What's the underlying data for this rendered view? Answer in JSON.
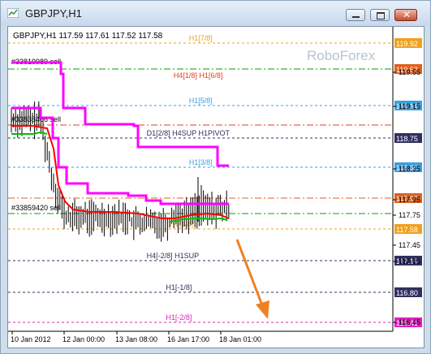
{
  "window": {
    "title": "GBPJPY,H1",
    "buttons": [
      "minimize",
      "maximize",
      "close"
    ]
  },
  "chart": {
    "header": "GBPJPY,H1  117.59 117.61 117.52 117.58",
    "watermark": "RoboForex",
    "time_labels": [
      "10 Jan 2012",
      "12 Jan 00:00",
      "13 Jan 08:00",
      "16 Jan 17:00",
      "18 Jan 01:00"
    ],
    "levels": [
      {
        "name": "H1[7/8]",
        "price": "119.92",
        "color": "#f0a020",
        "badge": "#f0a020",
        "style": "dash",
        "label_x_frac": 0.47
      },
      {
        "name": "",
        "price": "119.53",
        "color": "#00a000",
        "badge": "#e06020",
        "style": "dashdot",
        "label_x_frac": 0
      },
      {
        "name": "H4[1/8] H1[6/8]",
        "price": "",
        "color": "#e04020",
        "badge": "",
        "style": "none",
        "label_x_frac": 0.43
      },
      {
        "name": "H1[5/8]",
        "price": "119.14",
        "color": "#3aa0e0",
        "badge": "#3aa0e0",
        "style": "dash",
        "label_x_frac": 0.47
      },
      {
        "name": "",
        "price": "",
        "color": "#e04020",
        "badge": "",
        "style": "dashdot",
        "label_x_frac": 0
      },
      {
        "name": "D1[2/8] H4SUP H1PIVOT",
        "price": "118.75",
        "color": "#303060",
        "badge": "#303060",
        "style": "dash",
        "label_x_frac": 0.36
      },
      {
        "name": "H1[3/8]",
        "price": "118.36",
        "color": "#3aa0e0",
        "badge": "#3aa0e0",
        "style": "dash",
        "label_x_frac": 0.47
      },
      {
        "name": "",
        "price": "117.97",
        "color": "#e06020",
        "badge": "#e06020",
        "style": "dashdot",
        "label_x_frac": 0
      },
      {
        "name": "",
        "price": "",
        "color": "#00a000",
        "badge": "",
        "style": "dashdot",
        "label_x_frac": 0
      },
      {
        "name": "H1[1/8]",
        "price": "117.58",
        "color": "#f0a020",
        "badge": "#f0a020",
        "style": "dash",
        "label_x_frac": 0.42
      },
      {
        "name": "H4[-2/8] H1SUP",
        "price": "117.19",
        "color": "#303060",
        "badge": "#303060",
        "style": "dash",
        "label_x_frac": 0.36
      },
      {
        "name": "H1[-1/8]",
        "price": "116.80",
        "color": "#303060",
        "badge": "#303060",
        "style": "dash",
        "label_x_frac": 0.41
      },
      {
        "name": "H1[-2/8]",
        "price": "116.41",
        "color": "#e020c0",
        "badge": "#e020c0",
        "style": "dash",
        "label_x_frac": 0.41
      }
    ],
    "axis_labels": [
      "119.92",
      "119.55",
      "119.15",
      "118.75",
      "118.35",
      "117.95",
      "117.75",
      "117.45",
      "117.15",
      "116.80",
      "116.45"
    ],
    "order_labels": [
      "#33819989 sell",
      "#33838466 sell",
      "#33859420 sell"
    ],
    "colors": {
      "envelope": "#ff00ff",
      "ma_red": "#ff0000",
      "ma_green": "#00c000",
      "candles": "#000000",
      "arrow": "#f08020"
    }
  }
}
